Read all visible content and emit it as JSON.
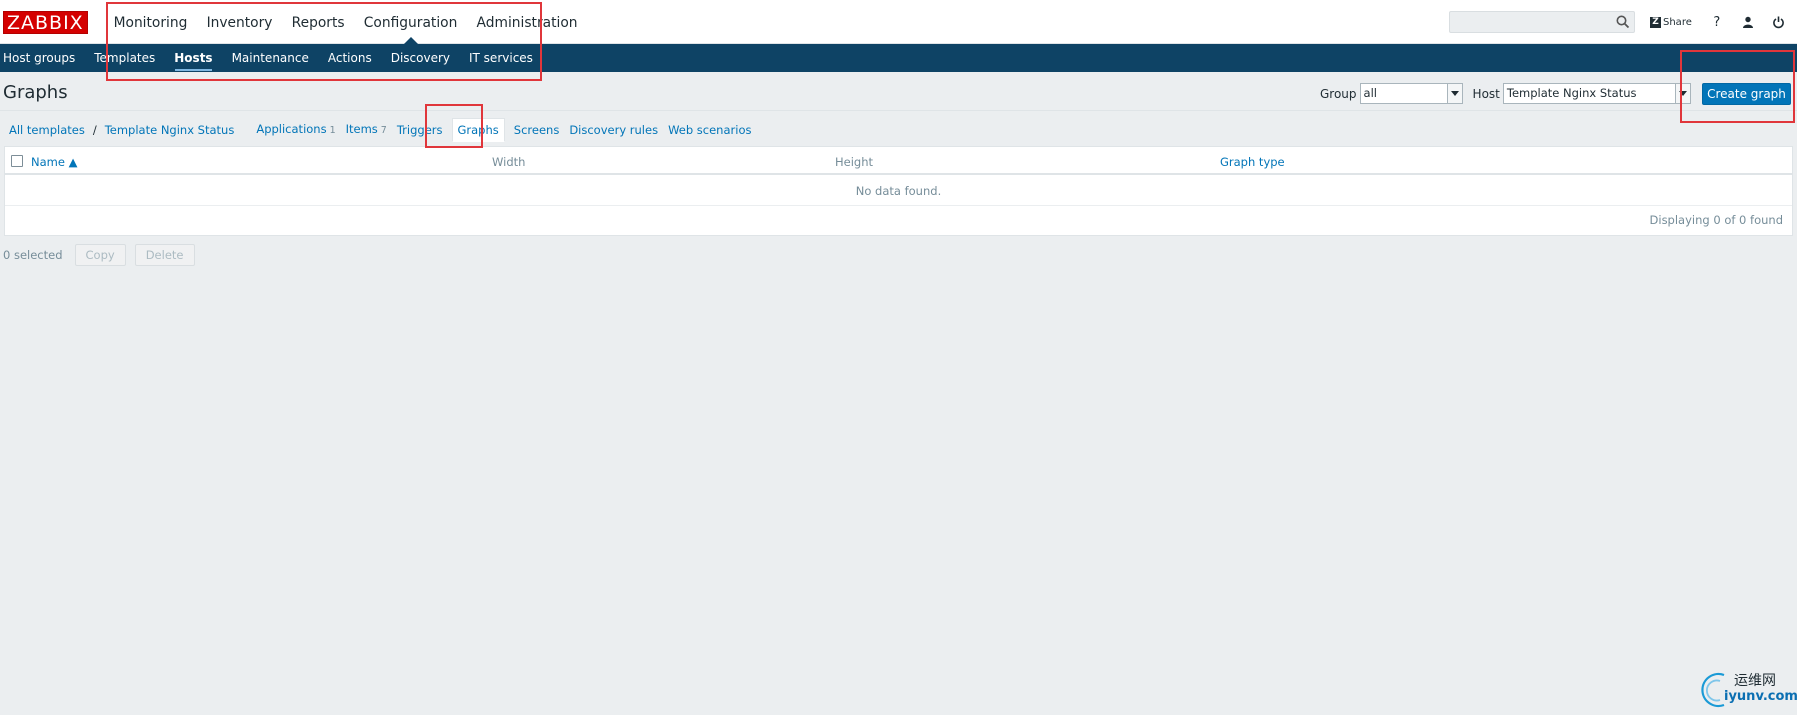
{
  "brand": {
    "logo": "ZABBIX"
  },
  "main_menu": {
    "items": [
      {
        "label": "Monitoring"
      },
      {
        "label": "Inventory"
      },
      {
        "label": "Reports"
      },
      {
        "label": "Configuration",
        "selected": true
      },
      {
        "label": "Administration"
      }
    ]
  },
  "topbar": {
    "search_value": "",
    "share_label": "Share",
    "help_icon": "question-icon",
    "profile_icon": "user-icon",
    "logout_icon": "power-icon"
  },
  "sub_menu": {
    "items": [
      {
        "label": "Host groups"
      },
      {
        "label": "Templates"
      },
      {
        "label": "Hosts",
        "selected": true
      },
      {
        "label": "Maintenance"
      },
      {
        "label": "Actions"
      },
      {
        "label": "Discovery"
      },
      {
        "label": "IT services"
      }
    ]
  },
  "page": {
    "title": "Graphs",
    "group_label": "Group",
    "group_value": "all",
    "host_label": "Host",
    "host_value": "Template Nginx Status",
    "create_label": "Create graph"
  },
  "breadcrumbs": {
    "all_templates": "All templates",
    "separator": "/",
    "template": "Template Nginx Status",
    "applications": "Applications",
    "applications_count": "1",
    "items": "Items",
    "items_count": "7",
    "triggers": "Triggers",
    "graphs": "Graphs",
    "screens": "Screens",
    "discovery_rules": "Discovery rules",
    "web_scenarios": "Web scenarios"
  },
  "table": {
    "columns": {
      "name": "Name ▲",
      "width": "Width",
      "height": "Height",
      "graph_type": "Graph type"
    },
    "empty_message": "No data found.",
    "footer": "Displaying 0 of 0 found"
  },
  "actions": {
    "selected_count": "0 selected",
    "copy_label": "Copy",
    "delete_label": "Delete"
  },
  "watermark": {
    "cn": "运维网",
    "en": "iyunv.com"
  },
  "colors": {
    "brand_red": "#d40000",
    "nav_dark": "#0e4365",
    "link_blue": "#0275b8",
    "background": "#ebeef0",
    "highlight_red": "#e0363b"
  }
}
